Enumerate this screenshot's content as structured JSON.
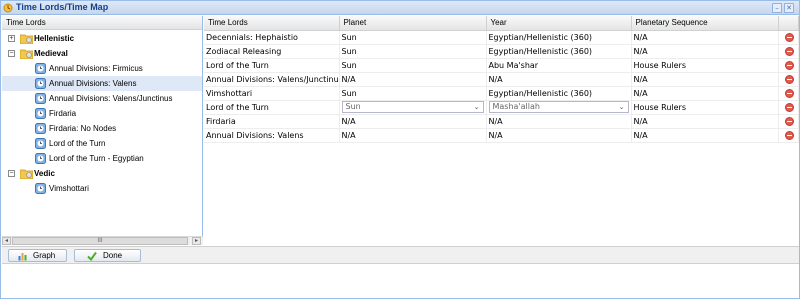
{
  "window": {
    "title": "Time Lords/Time Map"
  },
  "tree": {
    "header": "Time Lords",
    "groups": [
      {
        "label": "Hellenistic",
        "expanded": false,
        "children": []
      },
      {
        "label": "Medieval",
        "expanded": true,
        "children": [
          "Annual Divisions: Firmicus",
          "Annual Divisions: Valens",
          "Annual Divisions: Valens/Junctinus",
          "Firdaria",
          "Firdaria: No Nodes",
          "Lord of the Turn",
          "Lord of the Turn - Egyptian"
        ]
      },
      {
        "label": "Vedic",
        "expanded": true,
        "children": [
          "Vimshottari"
        ]
      }
    ],
    "selected": "Annual Divisions: Valens",
    "scroll_thumb_glyph": "III"
  },
  "grid": {
    "columns": [
      "Time Lords",
      "Planet",
      "Year",
      "Planetary Sequence",
      ""
    ],
    "rows": [
      {
        "time_lord": "Decennials: Hephaistio",
        "planet": "Sun",
        "year": "Egyptian/Hellenistic (360)",
        "sequence": "N/A"
      },
      {
        "time_lord": "Zodiacal Releasing",
        "planet": "Sun",
        "year": "Egyptian/Hellenistic (360)",
        "sequence": "N/A"
      },
      {
        "time_lord": "Lord of the Turn",
        "planet": "Sun",
        "year": "Abu Ma'shar",
        "sequence": "House Rulers"
      },
      {
        "time_lord": "Annual Divisions: Valens/Junctinus",
        "planet": "N/A",
        "year": "N/A",
        "sequence": "N/A"
      },
      {
        "time_lord": "Vimshottari",
        "planet": "Sun",
        "year": "Egyptian/Hellenistic (360)",
        "sequence": "N/A"
      },
      {
        "time_lord": "Lord of the Turn",
        "planet": "Sun",
        "year": "Masha'allah",
        "sequence": "House Rulers",
        "editing": true
      },
      {
        "time_lord": "Firdaria",
        "planet": "N/A",
        "year": "N/A",
        "sequence": "N/A"
      },
      {
        "time_lord": "Annual Divisions: Valens",
        "planet": "N/A",
        "year": "N/A",
        "sequence": "N/A"
      }
    ]
  },
  "toolbar": {
    "graph_label": "Graph",
    "done_label": "Done"
  },
  "colors": {
    "accent": "#99bbe8",
    "title_text": "#15428b",
    "selection": "#dfe8f6",
    "delete_icon": "#e05a4e",
    "done_check": "#4caf27"
  }
}
